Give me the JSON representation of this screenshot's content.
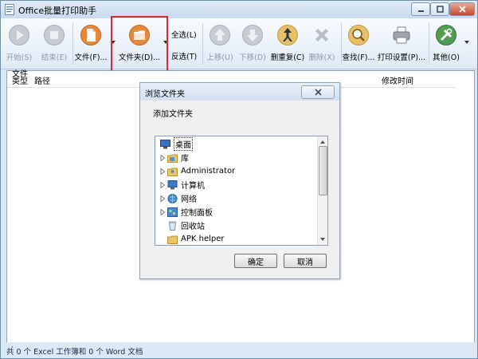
{
  "app": {
    "title": "Office批量打印助手"
  },
  "toolbar": {
    "start_label": "开始(S)",
    "stop_label": "结束(E)",
    "file_label": "文件(F)...",
    "folder_label": "文件夹(D)...",
    "select_all_label": "全选(L)",
    "invert_label": "反选(T)",
    "move_up_label": "上移(U)",
    "move_down_label": "下移(D)",
    "dedupe_label": "删重复(C)",
    "delete_label": "删除(X)",
    "find_label": "查找(F)...",
    "print_settings_label": "打印设置(P)...",
    "other_label": "其他(O)"
  },
  "list": {
    "columns": {
      "type_line1": "文件",
      "type_line2": "类型",
      "path": "路径",
      "modified": "修改时间"
    }
  },
  "statusbar": {
    "text": "共 0 个 Excel 工作簿和 0 个 Word 文档"
  },
  "dialog": {
    "title": "浏览文件夹",
    "description": "添加文件夹",
    "tree_items": [
      {
        "label": "桌面",
        "icon": "desktop-icon"
      },
      {
        "label": "库",
        "icon": "library-icon"
      },
      {
        "label": "Administrator",
        "icon": "user-folder-icon"
      },
      {
        "label": "计算机",
        "icon": "computer-icon"
      },
      {
        "label": "网络",
        "icon": "network-icon"
      },
      {
        "label": "控制面板",
        "icon": "control-panel-icon"
      },
      {
        "label": "回收站",
        "icon": "recycle-bin-icon"
      },
      {
        "label": "APK helper",
        "icon": "folder-icon"
      }
    ],
    "ok_label": "确定",
    "cancel_label": "取消"
  },
  "colors": {
    "highlight_border": "#e3272f",
    "window_bg": "#dbe8f6"
  }
}
